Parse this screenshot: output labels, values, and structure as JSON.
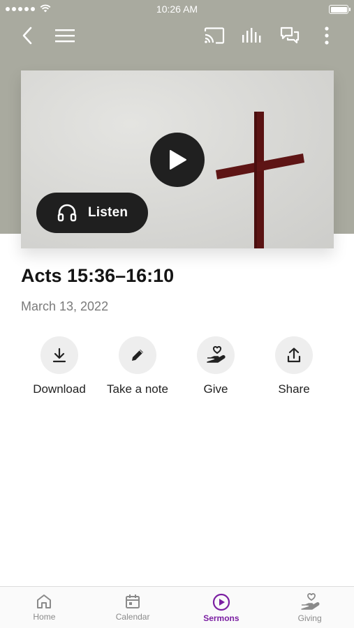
{
  "status_bar": {
    "time": "10:26 AM"
  },
  "top_bar": {
    "icons": [
      "back-icon",
      "menu-icon",
      "cast-icon",
      "audio-levels-icon",
      "chat-icon",
      "more-icon"
    ]
  },
  "media": {
    "listen_label": "Listen"
  },
  "sermon": {
    "title": "Acts 15:36–16:10",
    "date": "March 13, 2022"
  },
  "actions": [
    {
      "label": "Download",
      "icon": "download-icon"
    },
    {
      "label": "Take a note",
      "icon": "pencil-icon"
    },
    {
      "label": "Give",
      "icon": "giving-hand-icon"
    },
    {
      "label": "Share",
      "icon": "share-icon"
    }
  ],
  "tabs": [
    {
      "label": "Home",
      "icon": "home-icon",
      "active": false
    },
    {
      "label": "Calendar",
      "icon": "calendar-icon",
      "active": false
    },
    {
      "label": "Sermons",
      "icon": "play-circle-icon",
      "active": true
    },
    {
      "label": "Giving",
      "icon": "giving-hand-icon",
      "active": false
    }
  ],
  "colors": {
    "header_background": "#a9aa9f",
    "accent": "#7b1fa2",
    "cross": "#5a1313"
  }
}
